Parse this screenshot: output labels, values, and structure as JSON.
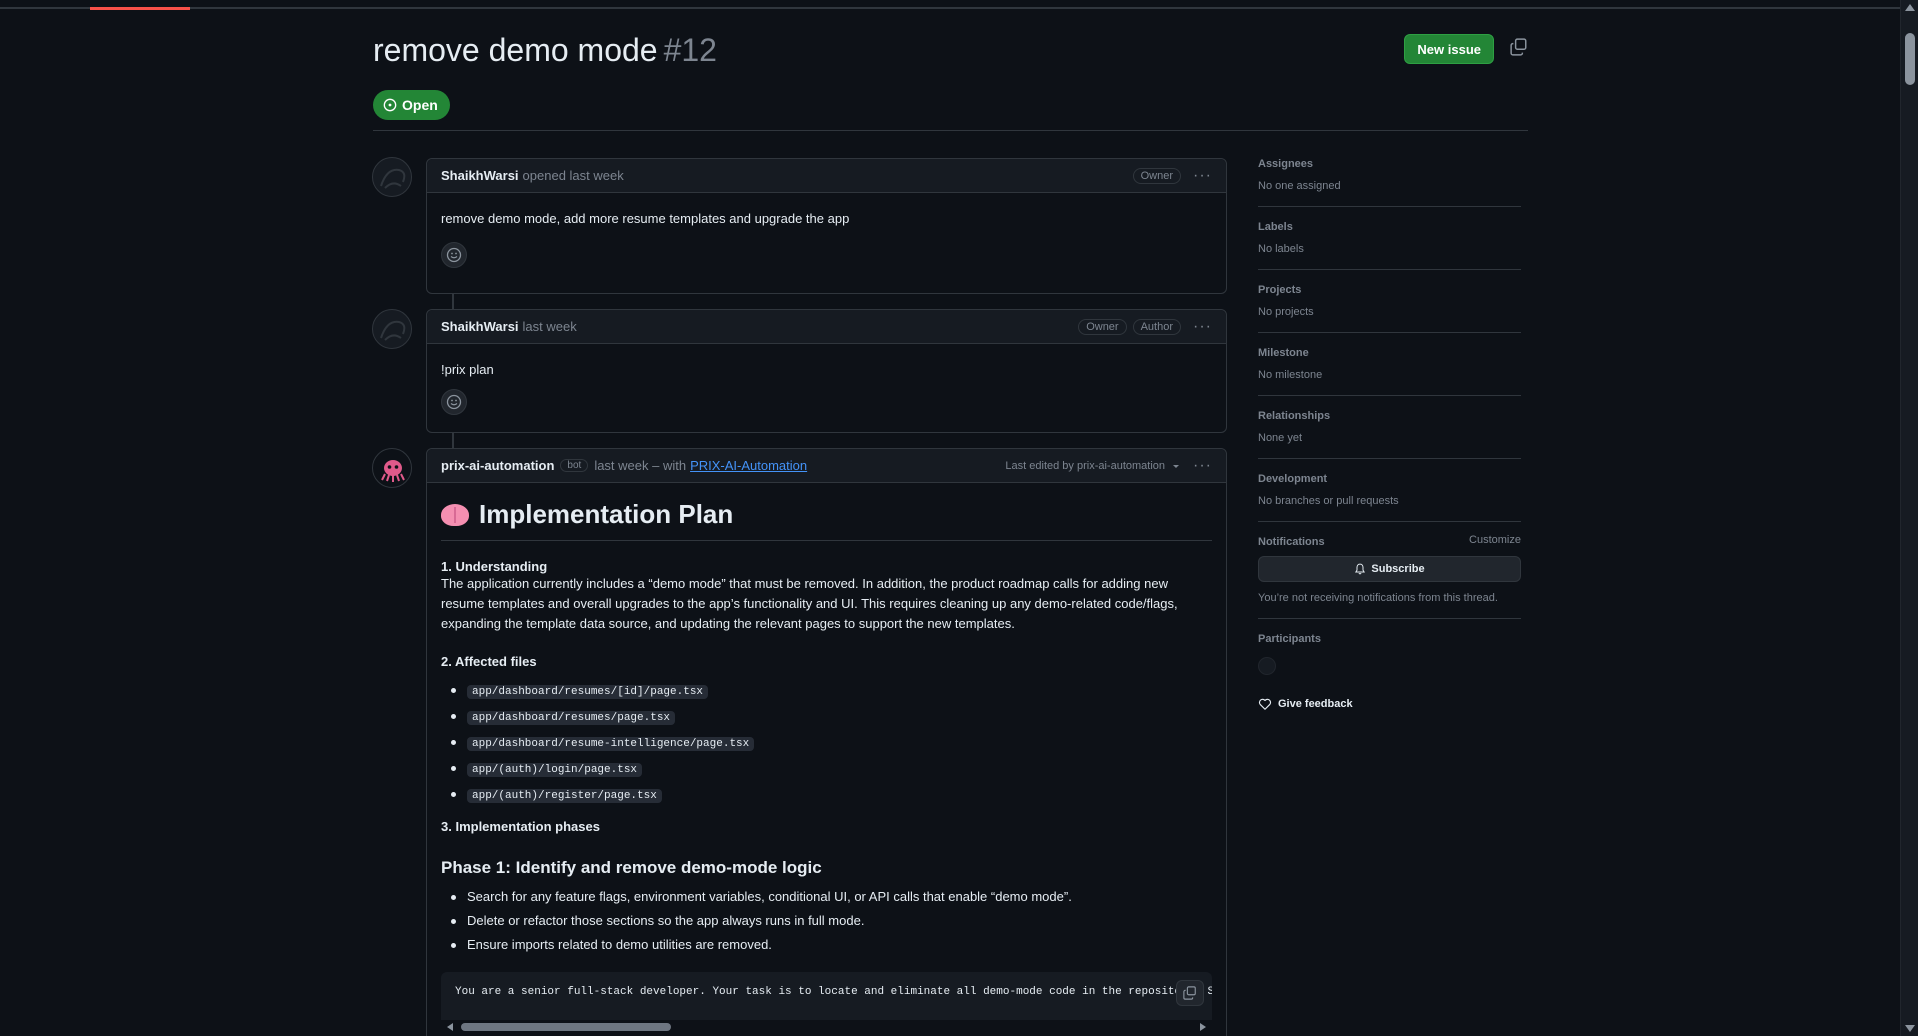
{
  "issue": {
    "title": "remove demo mode",
    "number": "#12",
    "state": "Open"
  },
  "header": {
    "new_issue_label": "New issue"
  },
  "comments": [
    {
      "author": "ShaikhWarsi",
      "meta": "opened last week",
      "labels": [
        "Owner"
      ],
      "body": "remove demo mode, add more resume templates and upgrade the app"
    },
    {
      "author": "ShaikhWarsi",
      "meta": "last week",
      "labels": [
        "Owner",
        "Author"
      ],
      "body": "!prix plan"
    }
  ],
  "bot_comment": {
    "author": "prix-ai-automation",
    "bot_label": "bot",
    "meta": "last week – with",
    "app_link": "PRIX-AI-Automation",
    "edited": "Last edited by prix-ai-automation",
    "plan": {
      "heading": "Implementation Plan",
      "sec1_title": "1. Understanding",
      "sec1_text": "The application currently includes a “demo mode” that must be removed. In addition, the product roadmap calls for adding new resume templates and overall upgrades to the app’s functionality and UI. This requires cleaning up any demo-related code/flags, expanding the template data source, and updating the relevant pages to support the new templates.",
      "sec2_title": "2. Affected files",
      "files": [
        "app/dashboard/resumes/[id]/page.tsx",
        "app/dashboard/resumes/page.tsx",
        "app/dashboard/resume-intelligence/page.tsx",
        "app/(auth)/login/page.tsx",
        "app/(auth)/register/page.tsx"
      ],
      "sec3_title": "3. Implementation phases",
      "phase1_title": "Phase 1: Identify and remove demo-mode logic",
      "phase1_items": [
        "Search for any feature flags, environment variables, conditional UI, or API calls that enable “demo mode”.",
        "Delete or refactor those sections so the app always runs in full mode.",
        "Ensure imports related to demo utilities are removed."
      ],
      "code_line": "You are a senior full-stack developer. Your task is to locate and eliminate all demo-mode code in the repository. Scan for"
    }
  },
  "sidebar": {
    "assignees": {
      "title": "Assignees",
      "value": "No one assigned"
    },
    "labels": {
      "title": "Labels",
      "value": "No labels"
    },
    "projects": {
      "title": "Projects",
      "value": "No projects"
    },
    "milestone": {
      "title": "Milestone",
      "value": "No milestone"
    },
    "relationships": {
      "title": "Relationships",
      "value": "None yet"
    },
    "development": {
      "title": "Development",
      "value": "No branches or pull requests"
    },
    "notifications": {
      "title": "Notifications",
      "customize": "Customize",
      "subscribe": "Subscribe",
      "note": "You’re not receiving notifications from this thread."
    },
    "participants": {
      "title": "Participants"
    },
    "feedback": "Give feedback"
  },
  "colors": {
    "accent_green": "#238636",
    "link": "#4493f8",
    "bg": "#0d1117",
    "border": "#30363d"
  },
  "icons": [
    "copy-icon",
    "issue-open-icon",
    "kebab-icon",
    "smiley-icon",
    "bell-icon",
    "heart-icon",
    "chevron-down-icon",
    "brain-emoji"
  ]
}
